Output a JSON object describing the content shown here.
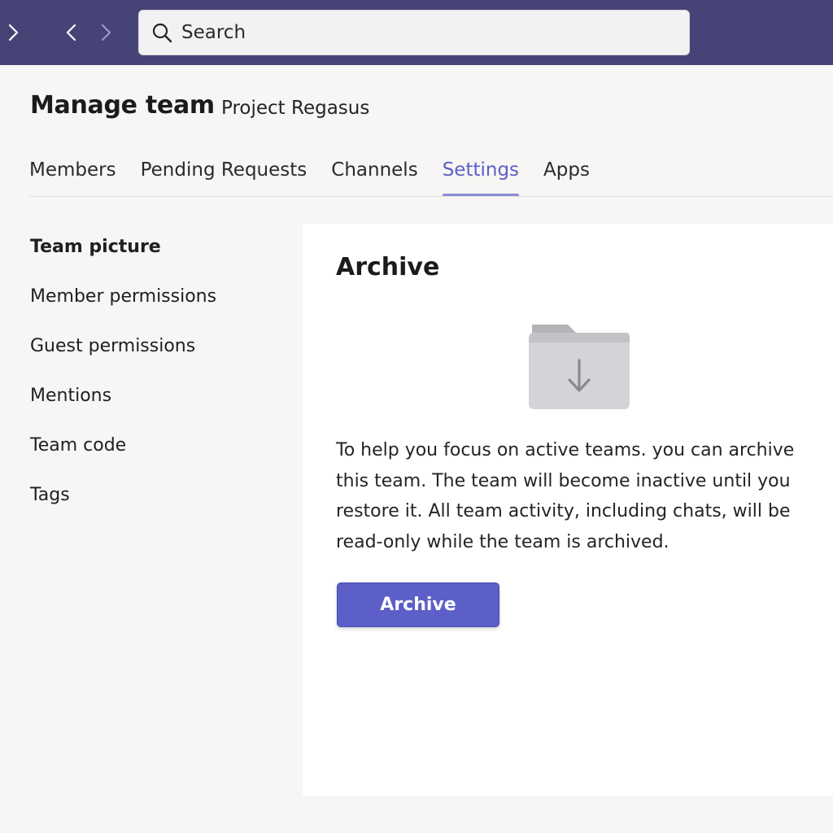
{
  "topbar": {
    "search_placeholder": "Search",
    "icons": {
      "expand": "chevron-right-icon",
      "back": "chevron-left-icon",
      "forward": "chevron-right-icon",
      "search": "search-icon"
    },
    "background_color": "#464476"
  },
  "header": {
    "title": "Manage team",
    "team_name": "Project Regasus"
  },
  "tabs": [
    {
      "label": "Members",
      "active": false
    },
    {
      "label": "Pending Requests",
      "active": false
    },
    {
      "label": "Channels",
      "active": false
    },
    {
      "label": "Settings",
      "active": true
    },
    {
      "label": "Apps",
      "active": false
    }
  ],
  "settings_nav": {
    "items": [
      {
        "label": "Team picture",
        "active": true
      },
      {
        "label": "Member permissions",
        "active": false
      },
      {
        "label": "Guest permissions",
        "active": false
      },
      {
        "label": "Mentions",
        "active": false
      },
      {
        "label": "Team code",
        "active": false
      },
      {
        "label": "Tags",
        "active": false
      }
    ]
  },
  "archive_panel": {
    "title": "Archive",
    "icon": "folder-download-icon",
    "description": "To help you focus on active teams. you can archive this team. The team will become inactive until you restore it. All team activity, including chats, will be read-only while the team is archived.",
    "button_label": "Archive"
  },
  "colors": {
    "accent": "#5b5fc7",
    "tab_underline": "#8b8cd9"
  }
}
